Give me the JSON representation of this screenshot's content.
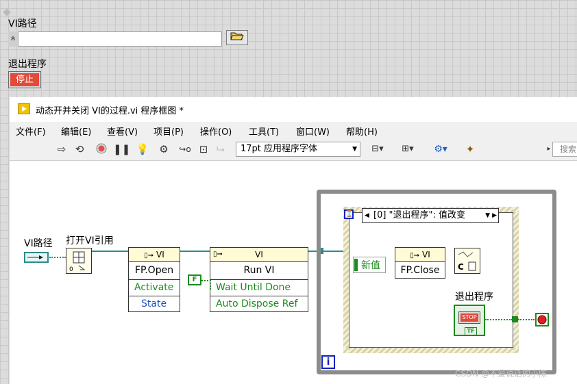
{
  "front_panel": {
    "path_label": "VI路径",
    "path_value": "",
    "path_tag": "ጸ",
    "stop_label": "退出程序",
    "stop_button": "停止"
  },
  "window": {
    "title": "动态开并关闭 VI的过程.vi 程序框图 *",
    "menus": [
      "文件(F)",
      "编辑(E)",
      "查看(V)",
      "项目(P)",
      "操作(O)",
      "工具(T)",
      "窗口(W)",
      "帮助(H)"
    ],
    "font_select": "17pt 应用程序字体",
    "search_placeholder": "搜索"
  },
  "diagram": {
    "path_terminal_label": "VI路径",
    "open_ref_label": "打开VI引用",
    "node1": {
      "head": "VI",
      "name": "FP.Open",
      "props": [
        "Activate",
        "State"
      ]
    },
    "node2": {
      "head": "VI",
      "name": "Run VI",
      "props": [
        "Wait Until Done",
        "Auto Dispose Ref"
      ]
    },
    "bool_const": "F",
    "event_selector": "[0] \"退出程序\": 值改变",
    "event_new_value": "新值",
    "node3": {
      "head": "VI",
      "name": "FP.Close"
    },
    "stop_terminal_label": "退出程序",
    "stop_terminal_text": "STOP",
    "stop_terminal_tf": "TF",
    "loop_index": "i",
    "close_ref_text": "C"
  },
  "watermark": "CSDN @不爱说话的小陈",
  "colors": {
    "wire_ref": "#2b8a8a",
    "wire_bool": "#1c8a1c",
    "stop_red": "#e24a3a",
    "loop_frame": "#8c8c8c"
  }
}
